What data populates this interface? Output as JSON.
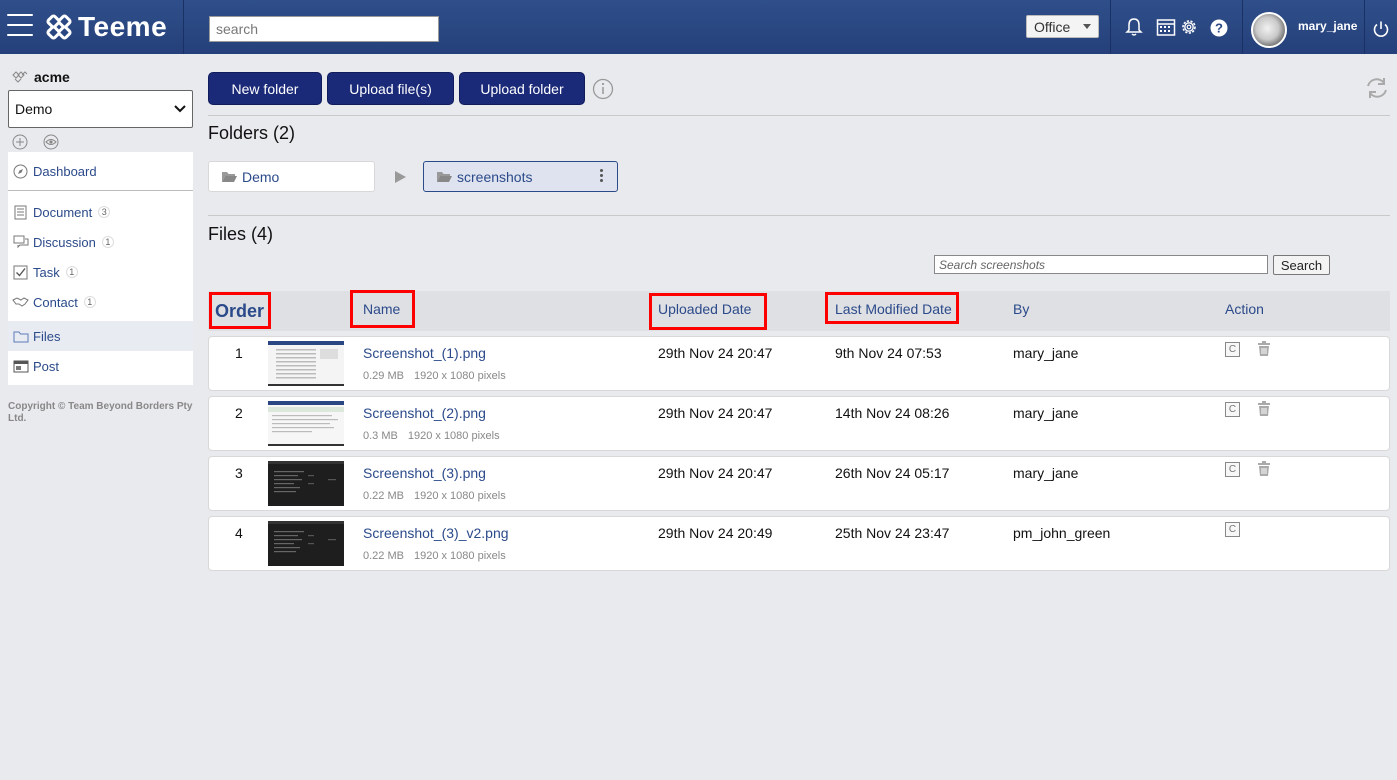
{
  "topbar": {
    "logo_text": "Teeme",
    "search_placeholder": "search",
    "workspace_select": "Office",
    "username": "mary_jane",
    "icons": [
      "menu-icon",
      "bell-icon",
      "calendar-icon",
      "gear-icon",
      "help-icon",
      "power-icon"
    ]
  },
  "sidebar": {
    "org_name": "acme",
    "space_select": "Demo",
    "nav": [
      {
        "label": "Dashboard",
        "icon": "compass-icon"
      },
      {
        "label": "Document",
        "icon": "document-icon",
        "count": "3"
      },
      {
        "label": "Discussion",
        "icon": "discussion-icon",
        "count": "1"
      },
      {
        "label": "Task",
        "icon": "task-icon",
        "count": "1"
      },
      {
        "label": "Contact",
        "icon": "handshake-icon",
        "count": "1"
      },
      {
        "label": "Files",
        "icon": "folder-icon"
      },
      {
        "label": "Post",
        "icon": "post-icon"
      }
    ],
    "copyright": "Copyright © Team Beyond Borders Pty Ltd."
  },
  "toolbar": {
    "new_folder": "New folder",
    "upload_files": "Upload file(s)",
    "upload_folder": "Upload folder"
  },
  "folders": {
    "title": "Folders (2)",
    "items": [
      {
        "name": "Demo"
      },
      {
        "name": "screenshots"
      }
    ]
  },
  "files": {
    "title": "Files (4)",
    "search_placeholder": "Search screenshots",
    "search_button": "Search",
    "columns": {
      "order": "Order",
      "name": "Name",
      "uploaded": "Uploaded Date",
      "modified": "Last Modified Date",
      "by": "By",
      "action": "Action"
    },
    "rows": [
      {
        "order": "1",
        "name": "Screenshot_(1).png",
        "size": "0.29 MB",
        "dims": "1920 x 1080 pixels",
        "uploaded": "29th Nov 24 20:47",
        "modified": "9th Nov 24 07:53",
        "by": "mary_jane",
        "copy": "C",
        "theme": "light"
      },
      {
        "order": "2",
        "name": "Screenshot_(2).png",
        "size": "0.3 MB",
        "dims": "1920 x 1080 pixels",
        "uploaded": "29th Nov 24 20:47",
        "modified": "14th Nov 24 08:26",
        "by": "mary_jane",
        "copy": "C",
        "theme": "light"
      },
      {
        "order": "3",
        "name": "Screenshot_(3).png",
        "size": "0.22 MB",
        "dims": "1920 x 1080 pixels",
        "uploaded": "29th Nov 24 20:47",
        "modified": "26th Nov 24 05:17",
        "by": "mary_jane",
        "copy": "C",
        "theme": "dark"
      },
      {
        "order": "4",
        "name": "Screenshot_(3)_v2.png",
        "size": "0.22 MB",
        "dims": "1920 x 1080 pixels",
        "uploaded": "29th Nov 24 20:49",
        "modified": "25th Nov 24 23:47",
        "by": "pm_john_green",
        "copy": "C",
        "theme": "dark"
      }
    ]
  },
  "colors": {
    "topbar": "#2a4784",
    "primary_button": "#1b2a78",
    "link": "#2b4a8a",
    "highlight": "#ff0000"
  }
}
